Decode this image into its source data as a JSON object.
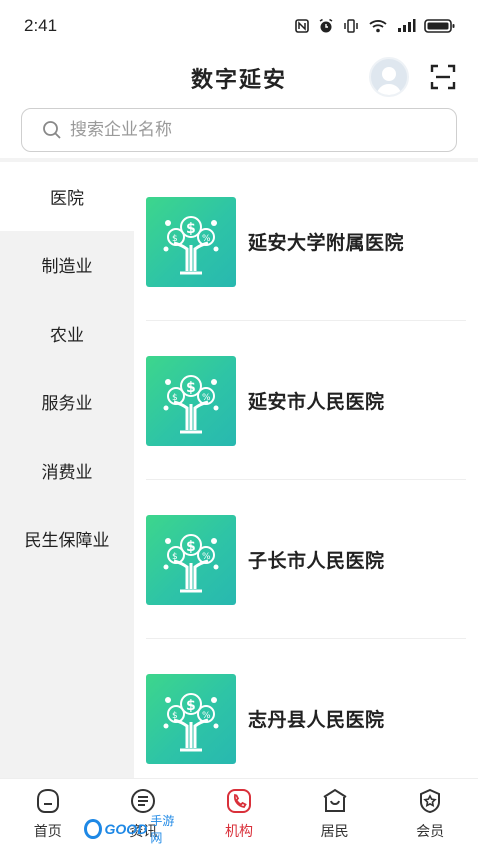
{
  "status_bar": {
    "time": "2:41"
  },
  "header": {
    "title": "数字延安"
  },
  "search": {
    "placeholder": "搜索企业名称"
  },
  "sidebar": {
    "items": [
      {
        "label": "医院",
        "active": true
      },
      {
        "label": "制造业",
        "active": false
      },
      {
        "label": "农业",
        "active": false
      },
      {
        "label": "服务业",
        "active": false
      },
      {
        "label": "消费业",
        "active": false
      },
      {
        "label": "民生保障业",
        "active": false
      }
    ]
  },
  "list": {
    "items": [
      {
        "name": "延安大学附属医院"
      },
      {
        "name": "延安市人民医院"
      },
      {
        "name": "子长市人民医院"
      },
      {
        "name": "志丹县人民医院"
      }
    ]
  },
  "tabbar": {
    "tabs": [
      {
        "label": "首页",
        "icon": "home-icon",
        "active": false
      },
      {
        "label": "资讯",
        "icon": "news-icon",
        "active": false
      },
      {
        "label": "机构",
        "icon": "institution-icon",
        "active": true
      },
      {
        "label": "居民",
        "icon": "resident-icon",
        "active": false
      },
      {
        "label": "会员",
        "icon": "member-icon",
        "active": false
      }
    ]
  },
  "watermark": {
    "brand": "GOOD",
    "text": "手游网"
  },
  "colors": {
    "accent": "#d9303a",
    "thumb": "#2ec4a6",
    "sidebar_bg": "#f2f2f2"
  }
}
